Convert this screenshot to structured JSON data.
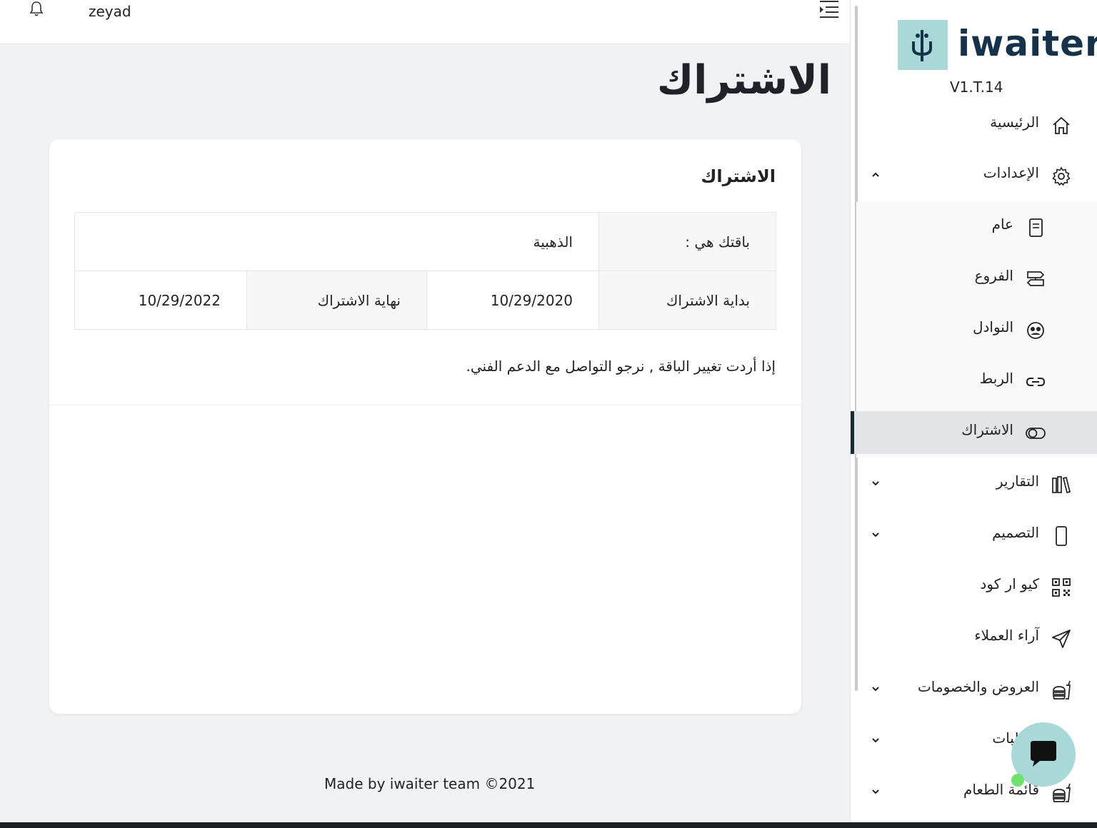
{
  "topbar": {
    "username": "zeyad"
  },
  "page": {
    "title": "الاشتراك"
  },
  "card": {
    "title": "الاشتراك",
    "package_label": "باقتك هي :",
    "package_value": "الذهبية",
    "start_label": "بداية الاشتراك",
    "start_value": "10/29/2020",
    "end_label": "نهاية الاشتراك",
    "end_value": "10/29/2022",
    "note": "إذا أردت تغيير الباقة , نرجو التواصل مع الدعم الفني."
  },
  "footer": {
    "text": "Made by iwaiter team ©2021"
  },
  "sidebar": {
    "logo_text": "iwaiter",
    "version": "V1.T.14",
    "items": {
      "home": "الرئيسية",
      "settings": "الإعدادات",
      "general": "عام",
      "branches": "الفروع",
      "waiters": "النوادل",
      "integration": "الربط",
      "subscription": "الاشتراك",
      "reports": "التقارير",
      "design": "التصميم",
      "qr_code": "كيو ار كود",
      "feedback": "آراء العملاء",
      "offers": "العروض والخصومات",
      "orders": "الطلبات",
      "menu": "قائمة الطعام"
    }
  },
  "colors": {
    "accent": "#a9d8d9",
    "brand_dark": "#16324a",
    "background": "#f1f2f4",
    "active_item": "#e3e4e7"
  }
}
